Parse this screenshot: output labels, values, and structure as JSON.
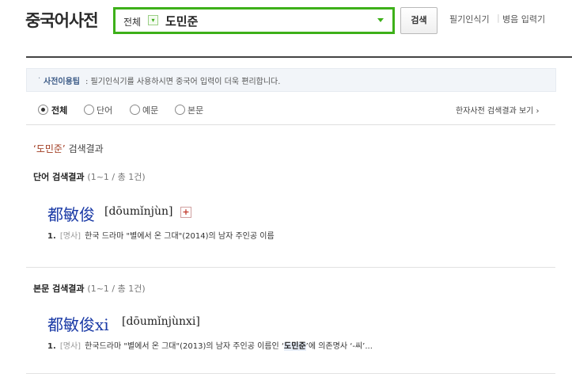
{
  "header": {
    "logo": "중국어사전",
    "search": {
      "category": "전체",
      "query": "도민준"
    },
    "search_button": "검색",
    "handwriting": "필기인식기",
    "separator": "|",
    "pinyin_input": "병음 입력기"
  },
  "tip": {
    "bullet": "·",
    "title": "사전이용팁",
    "text": ": 필기인식기를 사용하시면 중국어 입력이 더욱 편리합니다."
  },
  "filter": {
    "options": [
      {
        "label": "전체",
        "checked": true
      },
      {
        "label": "단어",
        "checked": false
      },
      {
        "label": "예문",
        "checked": false
      },
      {
        "label": "본문",
        "checked": false
      }
    ],
    "hanja_link": "한자사전 검색결과 보기 ›"
  },
  "result": {
    "heading_query": "‘도민준’",
    "heading_suffix": " 검색결과"
  },
  "word_section": {
    "title": "단어 검색결과",
    "count": "(1~1 / 총 1건)",
    "entries": [
      {
        "hanzi": "都敏俊",
        "pinyin": "[dōumǐnjùn]",
        "plus": "+",
        "num": "1.",
        "pos": "[명사]",
        "definition": "한국 드라마 \"별에서 온 그대\"(2014)의 남자 주인공 이름"
      }
    ]
  },
  "body_section": {
    "title": "본문 검색결과",
    "count": "(1~1 / 총 1건)",
    "entries": [
      {
        "hanzi": "都敏俊xi",
        "pinyin": "[dōumǐnjùnxi]",
        "num": "1.",
        "pos": "[명사]",
        "definition_pre": "한국드라마 \"별에서 온 그대\"(2013)의 남자 주인공 이름인 ‘",
        "definition_hl": "도민준",
        "definition_post": "’에 의존명사 ‘-씨’..."
      }
    ]
  }
}
